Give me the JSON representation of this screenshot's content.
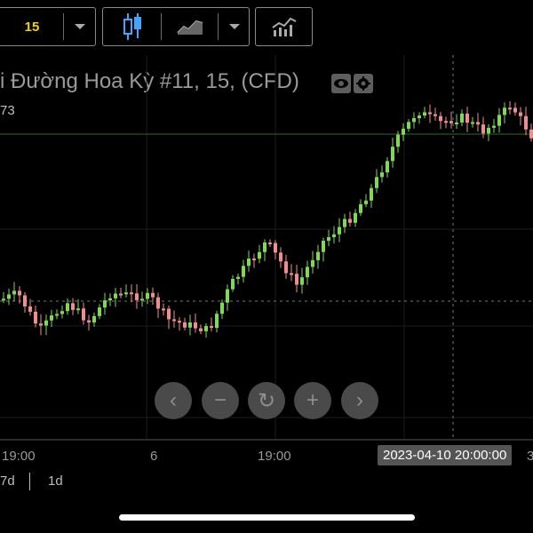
{
  "toolbar": {
    "interval_value": "15",
    "icons": [
      "chevron-down-icon",
      "candlestick-icon",
      "line-chart-icon",
      "chevron-down-icon",
      "indicators-icon"
    ]
  },
  "chart": {
    "title": "i Đường Hoa Kỳ #11, 15, (CFD)",
    "price_fragment": "73",
    "x_ticks": [
      "19:00",
      "6",
      "19:00"
    ],
    "crosshair_time": "2023-04-10 20:00:00",
    "edge_tick_fragment": "3",
    "colors": {
      "up": "#7ed957",
      "down": "#f08e8e",
      "guide_line": "#2e6b2e",
      "crosshair": "#777777"
    }
  },
  "navigation": {
    "buttons": [
      "‹",
      "−",
      "↻",
      "+",
      "›"
    ]
  },
  "ranges": [
    "7d",
    "1d"
  ]
}
